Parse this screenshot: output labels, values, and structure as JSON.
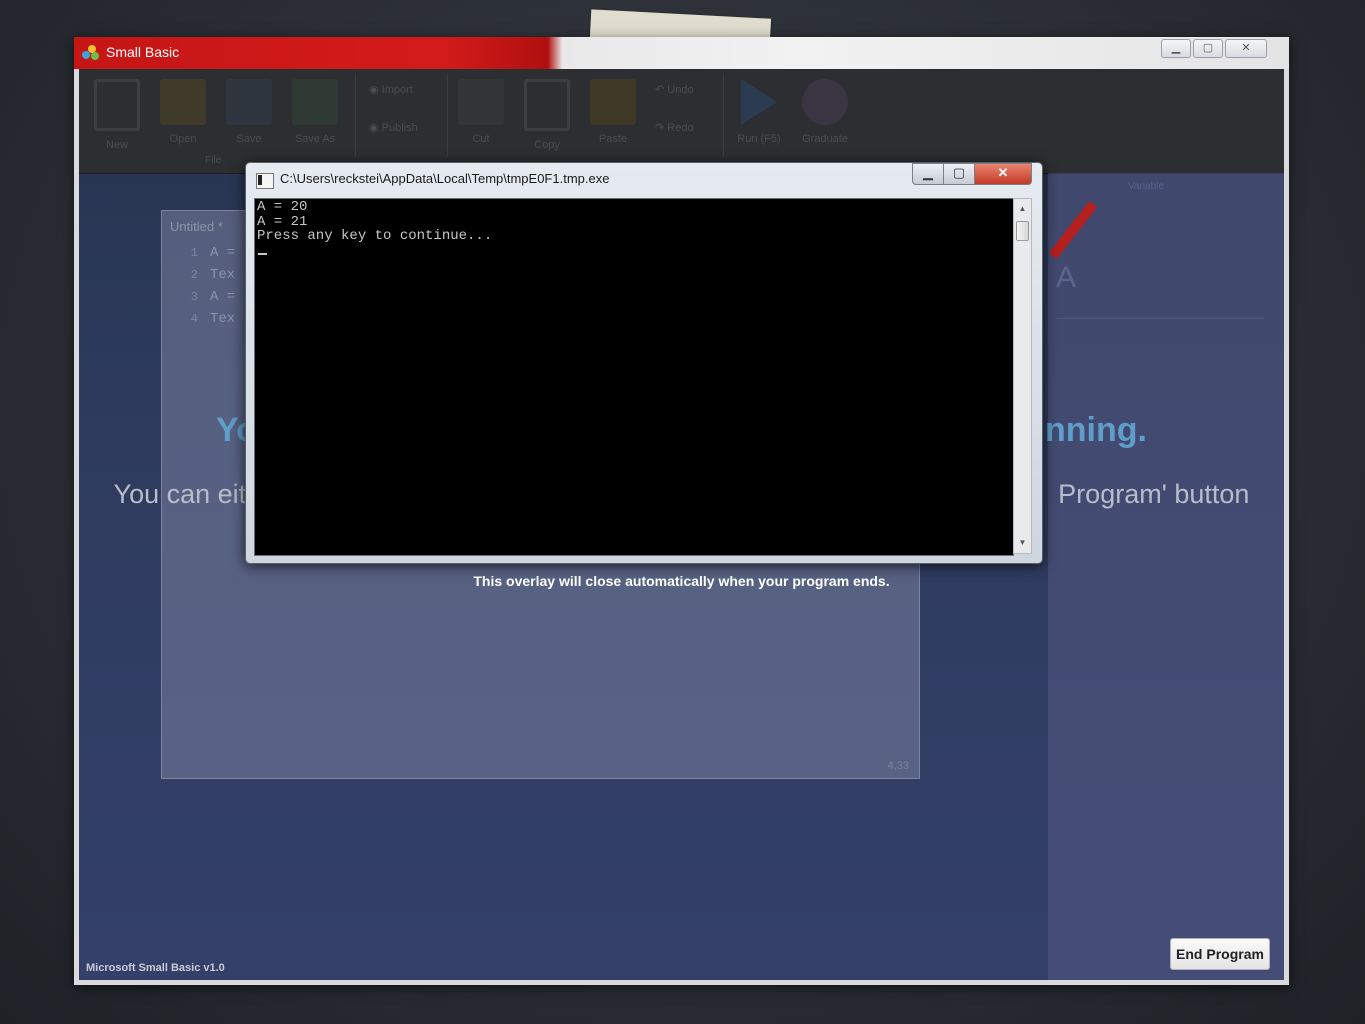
{
  "main_window": {
    "title": "Small Basic",
    "controls": [
      "minimize",
      "maximize",
      "close"
    ]
  },
  "ribbon": {
    "items": [
      {
        "label": "New",
        "icon": "new-file-icon"
      },
      {
        "label": "Open",
        "icon": "open-folder-icon"
      },
      {
        "label": "Save",
        "icon": "save-icon"
      },
      {
        "label": "Save As",
        "icon": "save-as-icon"
      },
      {
        "label": "Import",
        "icon": "import-icon"
      },
      {
        "label": "Publish",
        "icon": "publish-icon"
      },
      {
        "label": "Cut",
        "icon": "cut-icon"
      },
      {
        "label": "Copy",
        "icon": "copy-icon"
      },
      {
        "label": "Paste",
        "icon": "paste-icon"
      },
      {
        "label": "Undo",
        "icon": "undo-icon"
      },
      {
        "label": "Redo",
        "icon": "redo-icon"
      },
      {
        "label": "Run (F5)",
        "icon": "run-icon"
      },
      {
        "label": "Graduate",
        "icon": "graduate-icon"
      }
    ],
    "group_file": "File"
  },
  "editor": {
    "tab_title": "Untitled *",
    "lines": [
      {
        "num": "1",
        "code": "A ="
      },
      {
        "num": "2",
        "code": "Tex"
      },
      {
        "num": "3",
        "code": "A ="
      },
      {
        "num": "4",
        "code": "Tex"
      }
    ],
    "position": "4,33"
  },
  "right_panel": {
    "section_label": "Variable",
    "letter": "A"
  },
  "overlay": {
    "heading_left": "Yo",
    "heading_right": "nning.",
    "sub_left": "You can eit",
    "sub_right": "Program' button",
    "auto_close": "This overlay will close automatically when your program ends."
  },
  "console_window": {
    "title": "C:\\Users\\reckstei\\AppData\\Local\\Temp\\tmpE0F1.tmp.exe",
    "output": "A = 20\nA = 21\nPress any key to continue...",
    "close_glyph": "✕"
  },
  "status": {
    "version_text": "Microsoft Small Basic v1.0",
    "end_program_label": "End Program"
  },
  "colors": {
    "title_red": "#c51515",
    "overlay_heading": "#5e9ec8",
    "console_bg": "#000000",
    "console_text": "#c7c7c7"
  }
}
